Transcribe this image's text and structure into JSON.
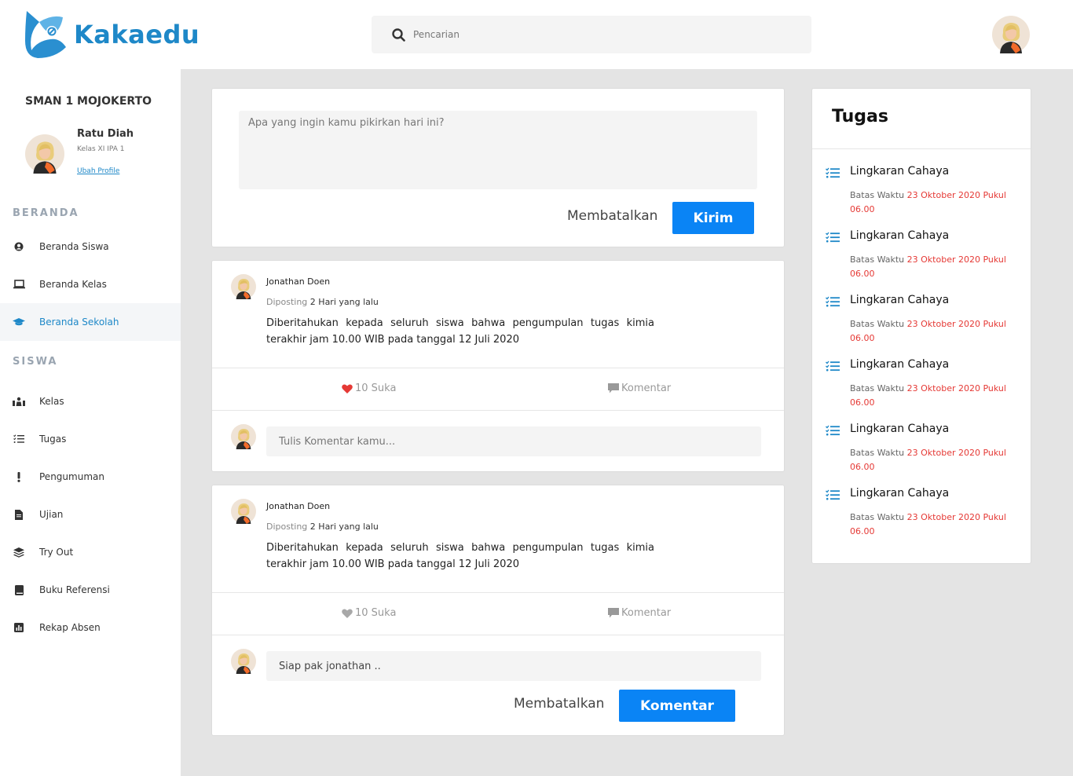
{
  "app": {
    "name": "Kakaedu"
  },
  "colors": {
    "brand": "#1e88c8",
    "primary_button": "#0a84f5",
    "deadline": "#e53935",
    "like_active": "#e53935"
  },
  "header": {
    "search_placeholder": "Pencarian",
    "search_icon": "search-icon"
  },
  "sidebar": {
    "school": "SMAN 1 MOJOKERTO",
    "profile": {
      "name": "Ratu Diah",
      "class": "Kelas XI IPA 1",
      "edit_link": "Ubah Profile"
    },
    "sections": [
      {
        "title": "BERANDA",
        "items": [
          {
            "label": "Beranda Siswa",
            "icon": "user-circle-icon"
          },
          {
            "label": "Beranda Kelas",
            "icon": "laptop-icon"
          },
          {
            "label": "Beranda Sekolah",
            "icon": "graduation-cap-icon",
            "active": true
          }
        ]
      },
      {
        "title": "SISWA",
        "items": [
          {
            "label": "Kelas",
            "icon": "classroom-icon"
          },
          {
            "label": "Tugas",
            "icon": "task-list-icon"
          },
          {
            "label": "Pengumuman",
            "icon": "exclamation-icon"
          },
          {
            "label": "Ujian",
            "icon": "file-icon"
          },
          {
            "label": "Try Out",
            "icon": "layers-icon"
          },
          {
            "label": "Buku Referensi",
            "icon": "book-icon"
          },
          {
            "label": "Rekap Absen",
            "icon": "chart-icon"
          }
        ]
      }
    ]
  },
  "composer": {
    "placeholder": "Apa yang ingin kamu pikirkan hari ini?",
    "cancel_label": "Membatalkan",
    "submit_label": "Kirim"
  },
  "posts": [
    {
      "author": "Jonathan Doen",
      "posted_label": "Diposting",
      "posted_time": "2 Hari yang lalu",
      "body": "Diberitahukan kepada seluruh siswa bahwa pengumpulan tugas kimia terakhir jam 10.00 WIB pada tanggal 12 Juli 2020",
      "likes_label": "10 Suka",
      "liked": true,
      "comment_label": "Komentar",
      "comment_placeholder": "Tulis Komentar kamu...",
      "comment_value": ""
    },
    {
      "author": "Jonathan Doen",
      "posted_label": "Diposting",
      "posted_time": "2 Hari yang lalu",
      "body": "Diberitahukan kepada seluruh siswa bahwa pengumpulan tugas kimia terakhir jam 10.00 WIB pada tanggal 12 Juli 2020",
      "likes_label": "10 Suka",
      "liked": false,
      "comment_label": "Komentar",
      "comment_placeholder": "",
      "comment_value": "Siap pak jonathan ..",
      "cancel_label": "Membatalkan",
      "submit_label": "Komentar"
    }
  ],
  "tasks": {
    "title": "Tugas",
    "items": [
      {
        "title": "Lingkaran Cahaya",
        "due_prefix": "Batas Waktu ",
        "due_date": "23 Oktober 2020 Pukul 06.00"
      },
      {
        "title": "Lingkaran Cahaya",
        "due_prefix": "Batas Waktu ",
        "due_date": "23 Oktober 2020 Pukul 06.00"
      },
      {
        "title": "Lingkaran Cahaya",
        "due_prefix": "Batas Waktu ",
        "due_date": "23 Oktober 2020 Pukul 06.00"
      },
      {
        "title": "Lingkaran Cahaya",
        "due_prefix": "Batas Waktu ",
        "due_date": "23 Oktober 2020 Pukul 06.00"
      },
      {
        "title": "Lingkaran Cahaya",
        "due_prefix": "Batas Waktu ",
        "due_date": "23 Oktober 2020 Pukul 06.00"
      },
      {
        "title": "Lingkaran Cahaya",
        "due_prefix": "Batas Waktu ",
        "due_date": "23 Oktober 2020 Pukul 06.00"
      }
    ]
  }
}
